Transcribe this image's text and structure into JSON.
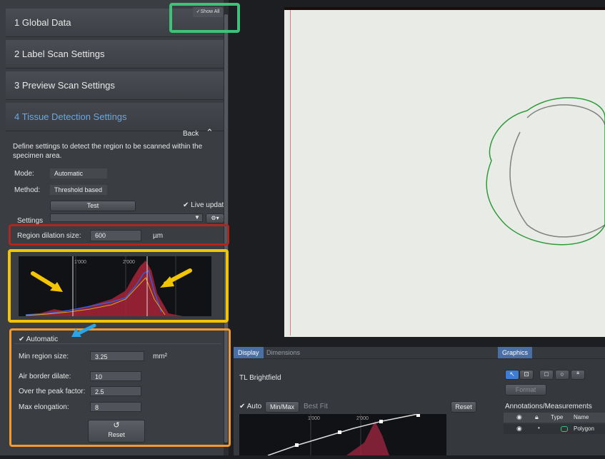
{
  "sections": [
    {
      "label": "1  Global Data"
    },
    {
      "label": "2  Label Scan Settings"
    },
    {
      "label": "3  Preview Scan Settings"
    },
    {
      "label": "4  Tissue Detection Settings"
    }
  ],
  "show_all": "✓Show All",
  "back_label": "Back",
  "description": "Define settings to detect the region to be scanned within the specimen area.",
  "mode": {
    "label": "Mode:",
    "value": "Automatic"
  },
  "method": {
    "label": "Method:",
    "value": "Threshold based"
  },
  "test_button": "Test",
  "live_update": "Live update",
  "settings_label": "Settings",
  "region_dilation": {
    "label": "Region dilation size:",
    "value": "600",
    "unit": "µm"
  },
  "histogram": {
    "tick1": "1'000",
    "tick2": "2'000"
  },
  "automatic_label": "Automatic",
  "min_region": {
    "label": "Min region size:",
    "value": "3.25",
    "unit": "mm²"
  },
  "air_border": {
    "label": "Air border dilate:",
    "value": "10"
  },
  "peak_factor": {
    "label": "Over the peak factor:",
    "value": "2.5"
  },
  "max_elongation": {
    "label": "Max elongation:",
    "value": "8"
  },
  "reset_label": "Reset",
  "display_panel": {
    "tab_display": "Display",
    "tab_dimensions": "Dimensions",
    "channel": "TL Brightfield",
    "auto": "Auto",
    "minmax": "Min/Max",
    "bestfit": "Best Fit",
    "reset": "Reset",
    "tick1": "1'000",
    "tick2": "2'000"
  },
  "graphics_panel": {
    "tab": "Graphics",
    "format": "Format",
    "annotations": "Annotations/Measurements",
    "col_type": "Type",
    "col_name": "Name",
    "row_name": "Polygon"
  },
  "colors": {
    "red_box": "#b0261c",
    "yellow_box": "#f2c500",
    "orange_box": "#f29a2e",
    "green_box": "#3ec27a",
    "blue_arrow": "#2aa6e8"
  }
}
